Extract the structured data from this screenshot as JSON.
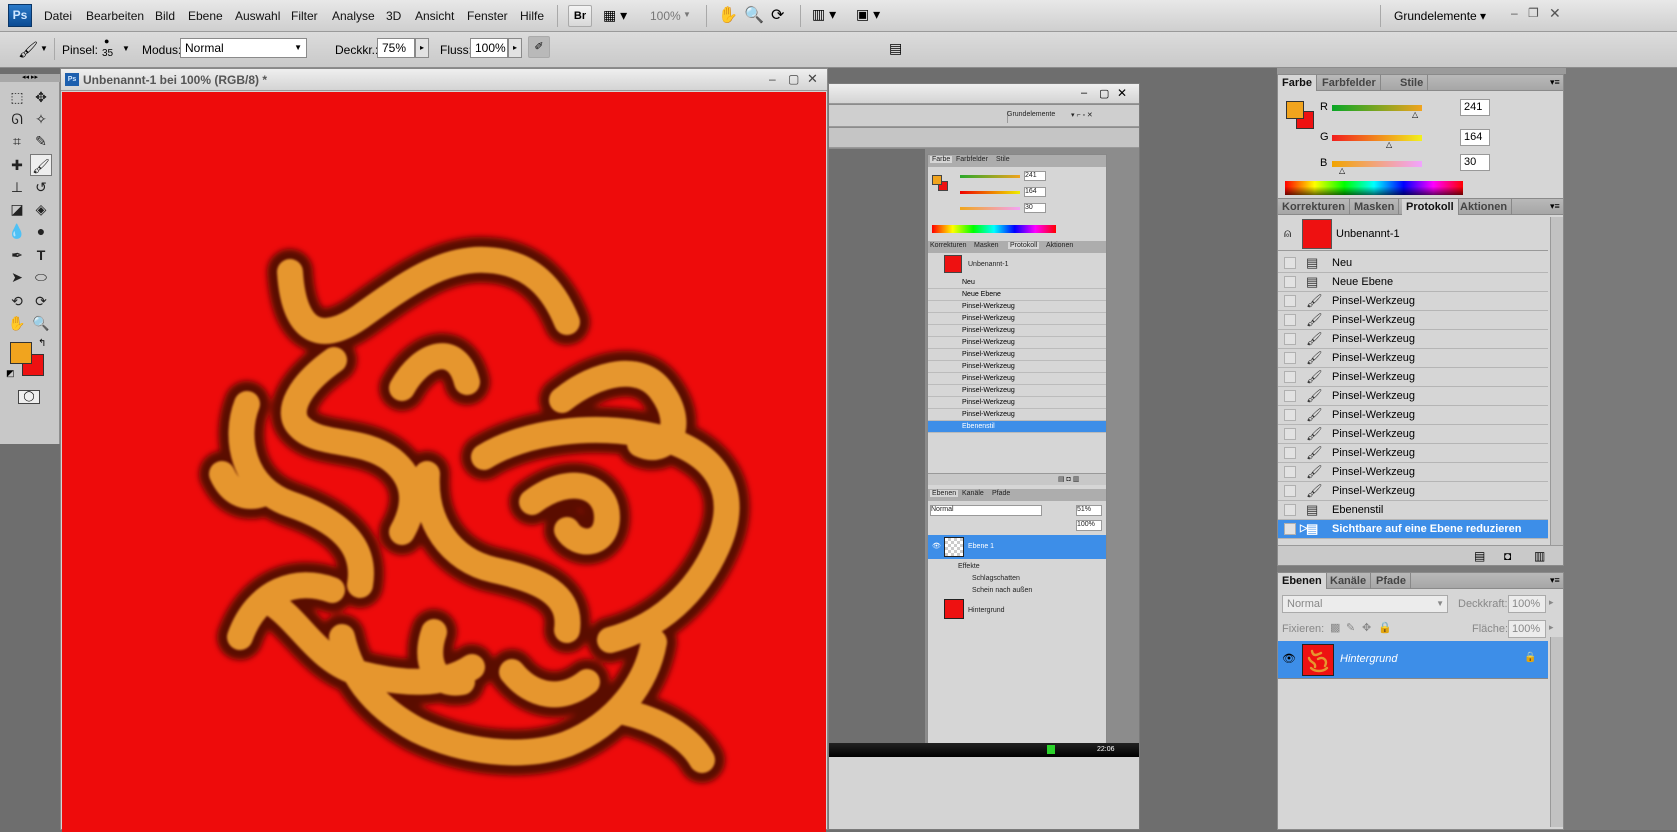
{
  "app": {
    "logo": "Ps"
  },
  "menu": [
    "Datei",
    "Bearbeiten",
    "Bild",
    "Ebene",
    "Auswahl",
    "Filter",
    "Analyse",
    "3D",
    "Ansicht",
    "Fenster",
    "Hilfe"
  ],
  "appbar": {
    "bridge_label": "Br",
    "zoom": "100%",
    "workspace": "Grundelemente ▾"
  },
  "options": {
    "brush_label": "Pinsel:",
    "brush_size": "35",
    "mode_label": "Modus:",
    "mode_value": "Normal",
    "opacity_label": "Deckkr.:",
    "opacity_value": "75%",
    "flow_label": "Fluss:",
    "flow_value": "100%"
  },
  "document": {
    "title": "Unbenannt-1 bei 100% (RGB/8) *",
    "ps_icon": "Ps"
  },
  "color_panel": {
    "tabs": [
      "Farbe",
      "Farbfelder",
      "Stile"
    ],
    "channels": [
      {
        "label": "R",
        "value": "241"
      },
      {
        "label": "G",
        "value": "164"
      },
      {
        "label": "B",
        "value": "30"
      }
    ],
    "foreground": "#f1a41e",
    "background": "#ee1111"
  },
  "history_panel": {
    "tabs": [
      "Korrekturen",
      "Masken",
      "Protokoll",
      "Aktionen"
    ],
    "snapshot": "Unbenannt-1",
    "items": [
      "Neu",
      "Neue Ebene",
      "Pinsel-Werkzeug",
      "Pinsel-Werkzeug",
      "Pinsel-Werkzeug",
      "Pinsel-Werkzeug",
      "Pinsel-Werkzeug",
      "Pinsel-Werkzeug",
      "Pinsel-Werkzeug",
      "Pinsel-Werkzeug",
      "Pinsel-Werkzeug",
      "Pinsel-Werkzeug",
      "Pinsel-Werkzeug",
      "Ebenenstil",
      "Sichtbare auf eine Ebene reduzieren"
    ]
  },
  "layers_panel": {
    "tabs": [
      "Ebenen",
      "Kanäle",
      "Pfade"
    ],
    "blend_mode": "Normal",
    "opacity_label": "Deckkraft:",
    "opacity_value": "100%",
    "lock_label": "Fixieren:",
    "fill_label": "Fläche:",
    "fill_value": "100%",
    "layer_name": "Hintergrund"
  },
  "screenshot_inset": {
    "workspace": "Grundelemente",
    "color_tabs": [
      "Farbe",
      "Farbfelder",
      "Stile"
    ],
    "color_values": [
      "241",
      "164",
      "30"
    ],
    "history_tabs": [
      "Korrekturen",
      "Masken",
      "Protokoll",
      "Aktionen"
    ],
    "snapshot": "Unbenannt-1",
    "items": [
      "Neu",
      "Neue Ebene",
      "Pinsel-Werkzeug",
      "Pinsel-Werkzeug",
      "Pinsel-Werkzeug",
      "Pinsel-Werkzeug",
      "Pinsel-Werkzeug",
      "Pinsel-Werkzeug",
      "Pinsel-Werkzeug",
      "Pinsel-Werkzeug",
      "Pinsel-Werkzeug",
      "Pinsel-Werkzeug",
      "Ebenenstil"
    ],
    "layers_tabs": [
      "Ebenen",
      "Kanäle",
      "Pfade"
    ],
    "blend": "Normal",
    "opacity": "51%",
    "fill": "100%",
    "layer1": "Ebene 1",
    "effects": "Effekte",
    "effect1": "Schlagschatten",
    "effect2": "Schein nach außen",
    "layer2": "Hintergrund",
    "clock": "22:06"
  }
}
